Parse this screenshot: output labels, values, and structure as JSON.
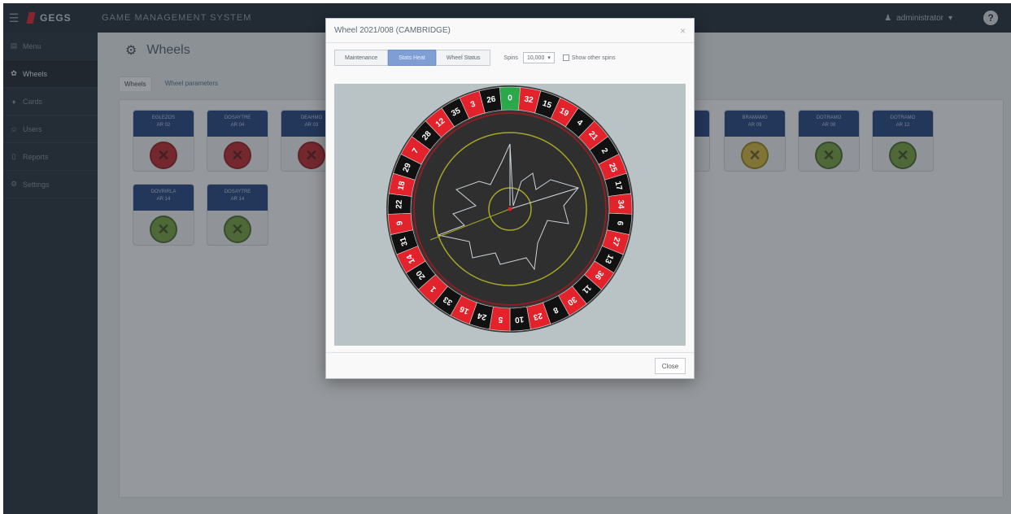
{
  "topbar": {
    "logo_text": "GEGS",
    "app_title": "GAME MANAGEMENT SYSTEM",
    "user_label": "administrator"
  },
  "sidebar": {
    "items": [
      {
        "label": "Menu",
        "icon": "menu-icon"
      },
      {
        "label": "Wheels",
        "icon": "gear-icon"
      },
      {
        "label": "Cards",
        "icon": "cards-icon"
      },
      {
        "label": "Users",
        "icon": "users-icon"
      },
      {
        "label": "Reports",
        "icon": "report-icon"
      },
      {
        "label": "Settings",
        "icon": "settings-icon"
      }
    ],
    "active_index": 1
  },
  "page": {
    "title": "Wheels",
    "tabs": [
      "Wheels",
      "Wheel parameters"
    ],
    "active_tab": 0
  },
  "cards": [
    {
      "line1": "EGLEZOS",
      "line2": "AR 02",
      "status": "red"
    },
    {
      "line1": "DOSAYTRE",
      "line2": "AR 04",
      "status": "red"
    },
    {
      "line1": "DEAHMO",
      "line2": "AR 03",
      "status": "red"
    },
    {
      "line1": "",
      "line2": "",
      "status": "yellow"
    },
    {
      "line1": "BRAMAMO",
      "line2": "AR 09",
      "status": "yellow"
    },
    {
      "line1": "DOTRAMO",
      "line2": "AR 08",
      "status": "green"
    },
    {
      "line1": "DOTRAMO",
      "line2": "AR 12",
      "status": "green"
    },
    {
      "line1": "DOVRIRLA",
      "line2": "AR 14",
      "status": "green"
    },
    {
      "line1": "DOSAYTRE",
      "line2": "AR 14",
      "status": "green"
    }
  ],
  "modal": {
    "title": "Wheel 2021/008 (CAMBRIDGE)",
    "tabs": [
      "Maintenance",
      "Stats Heat",
      "Wheel Status"
    ],
    "active_tab": 1,
    "spins_label": "Spins",
    "spins_value": "10,000",
    "other_spins_label": "Show other spins",
    "close_label": "Close"
  },
  "wheel_numbers": [
    0,
    32,
    15,
    19,
    4,
    21,
    2,
    25,
    17,
    34,
    6,
    27,
    13,
    36,
    11,
    30,
    8,
    23,
    10,
    5,
    24,
    16,
    33,
    1,
    20,
    14,
    31,
    9,
    22,
    18,
    29,
    7,
    28,
    12,
    35,
    3,
    26
  ],
  "colors": {
    "red": "#e2232c",
    "black": "#111111",
    "green": "#2aa84a",
    "card_head": "#20417a"
  }
}
